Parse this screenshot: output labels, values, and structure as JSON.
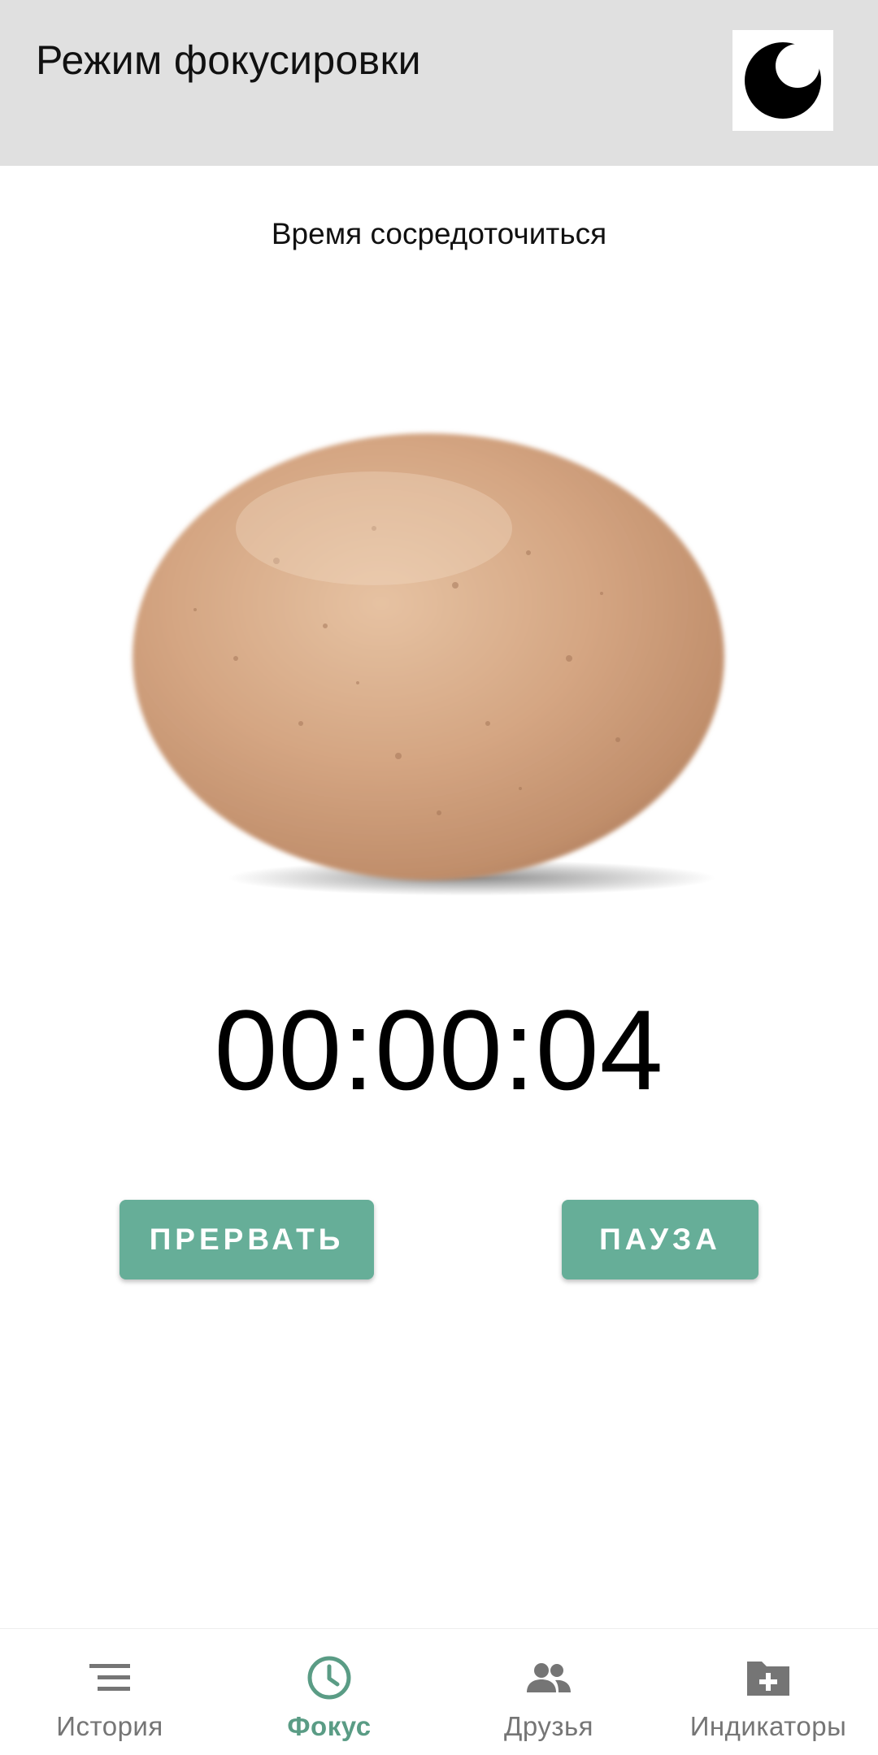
{
  "header": {
    "title": "Режим фокусировки",
    "theme_toggle_icon": "moon-icon"
  },
  "focus": {
    "subtitle": "Время сосредоточиться",
    "illustration": "potato-image",
    "timer": "00:00:04",
    "abort_label": "ПРЕРВАТЬ",
    "pause_label": "ПАУЗА"
  },
  "nav": {
    "items": [
      {
        "label": "История",
        "icon": "list-icon",
        "active": false
      },
      {
        "label": "Фокус",
        "icon": "clock-icon",
        "active": true
      },
      {
        "label": "Друзья",
        "icon": "people-icon",
        "active": false
      },
      {
        "label": "Индикаторы",
        "icon": "folder-plus-icon",
        "active": false
      }
    ]
  },
  "colors": {
    "appbar_bg": "#e0e0e0",
    "accent": "#66ae98",
    "nav_active": "#5a9c85",
    "nav_inactive": "#757575"
  }
}
